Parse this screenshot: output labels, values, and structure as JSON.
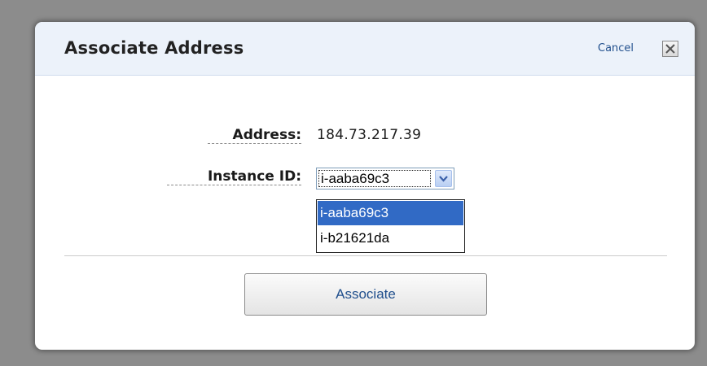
{
  "dialog": {
    "title": "Associate Address",
    "cancel_label": "Cancel",
    "close_icon": "close-icon"
  },
  "form": {
    "address_label": "Address:",
    "address_value": "184.73.217.39",
    "instance_label": "Instance ID:",
    "instance_selected": "i-aaba69c3",
    "instance_options": [
      "i-aaba69c3",
      "i-b21621da"
    ]
  },
  "actions": {
    "associate_label": "Associate"
  },
  "colors": {
    "header_bg": "#ecf2fa",
    "link": "#1f4e8c",
    "selection": "#316ac5"
  }
}
